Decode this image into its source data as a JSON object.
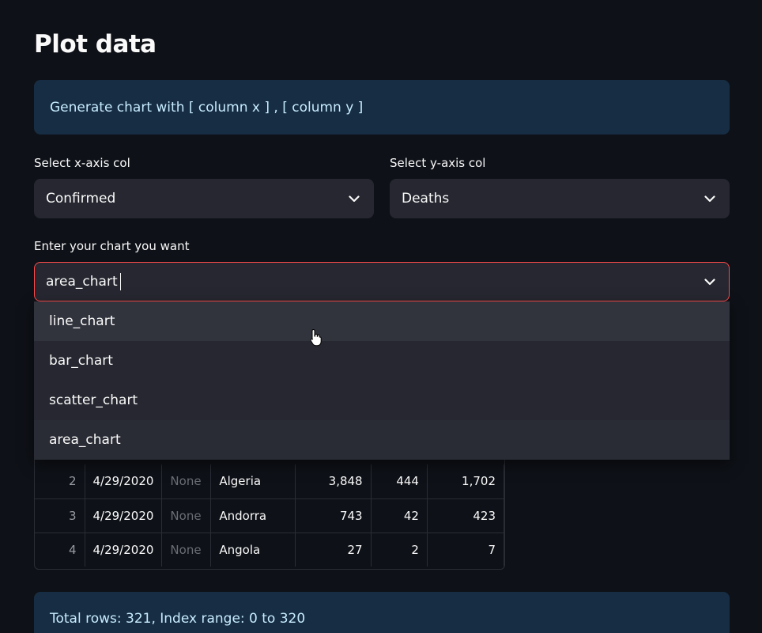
{
  "header": {
    "title": "Plot data"
  },
  "info": {
    "text": "Generate chart with [ column x ] , [ column y ]"
  },
  "x_select": {
    "label": "Select x-axis col",
    "value": "Confirmed",
    "icon": "chevron-down-icon"
  },
  "y_select": {
    "label": "Select y-axis col",
    "value": "Deaths",
    "icon": "chevron-down-icon"
  },
  "chart_select": {
    "label": "Enter your chart you want",
    "value": "area_chart",
    "options": [
      "line_chart",
      "bar_chart",
      "scatter_chart",
      "area_chart"
    ],
    "hovered_option": "line_chart"
  },
  "table": {
    "rows": [
      [
        "2",
        "4/29/2020",
        "None",
        "Algeria",
        "3,848",
        "444",
        "1,702"
      ],
      [
        "3",
        "4/29/2020",
        "None",
        "Andorra",
        "743",
        "42",
        "423"
      ],
      [
        "4",
        "4/29/2020",
        "None",
        "Angola",
        "27",
        "2",
        "7"
      ]
    ]
  },
  "footer": {
    "text": "Total rows: 321, Index range: 0 to 320"
  },
  "colors": {
    "background": "#0e1117",
    "info_bg": "#172d43",
    "info_text": "#c7ebff",
    "input_bg": "#262730",
    "focus_border": "#ff4b4b"
  }
}
